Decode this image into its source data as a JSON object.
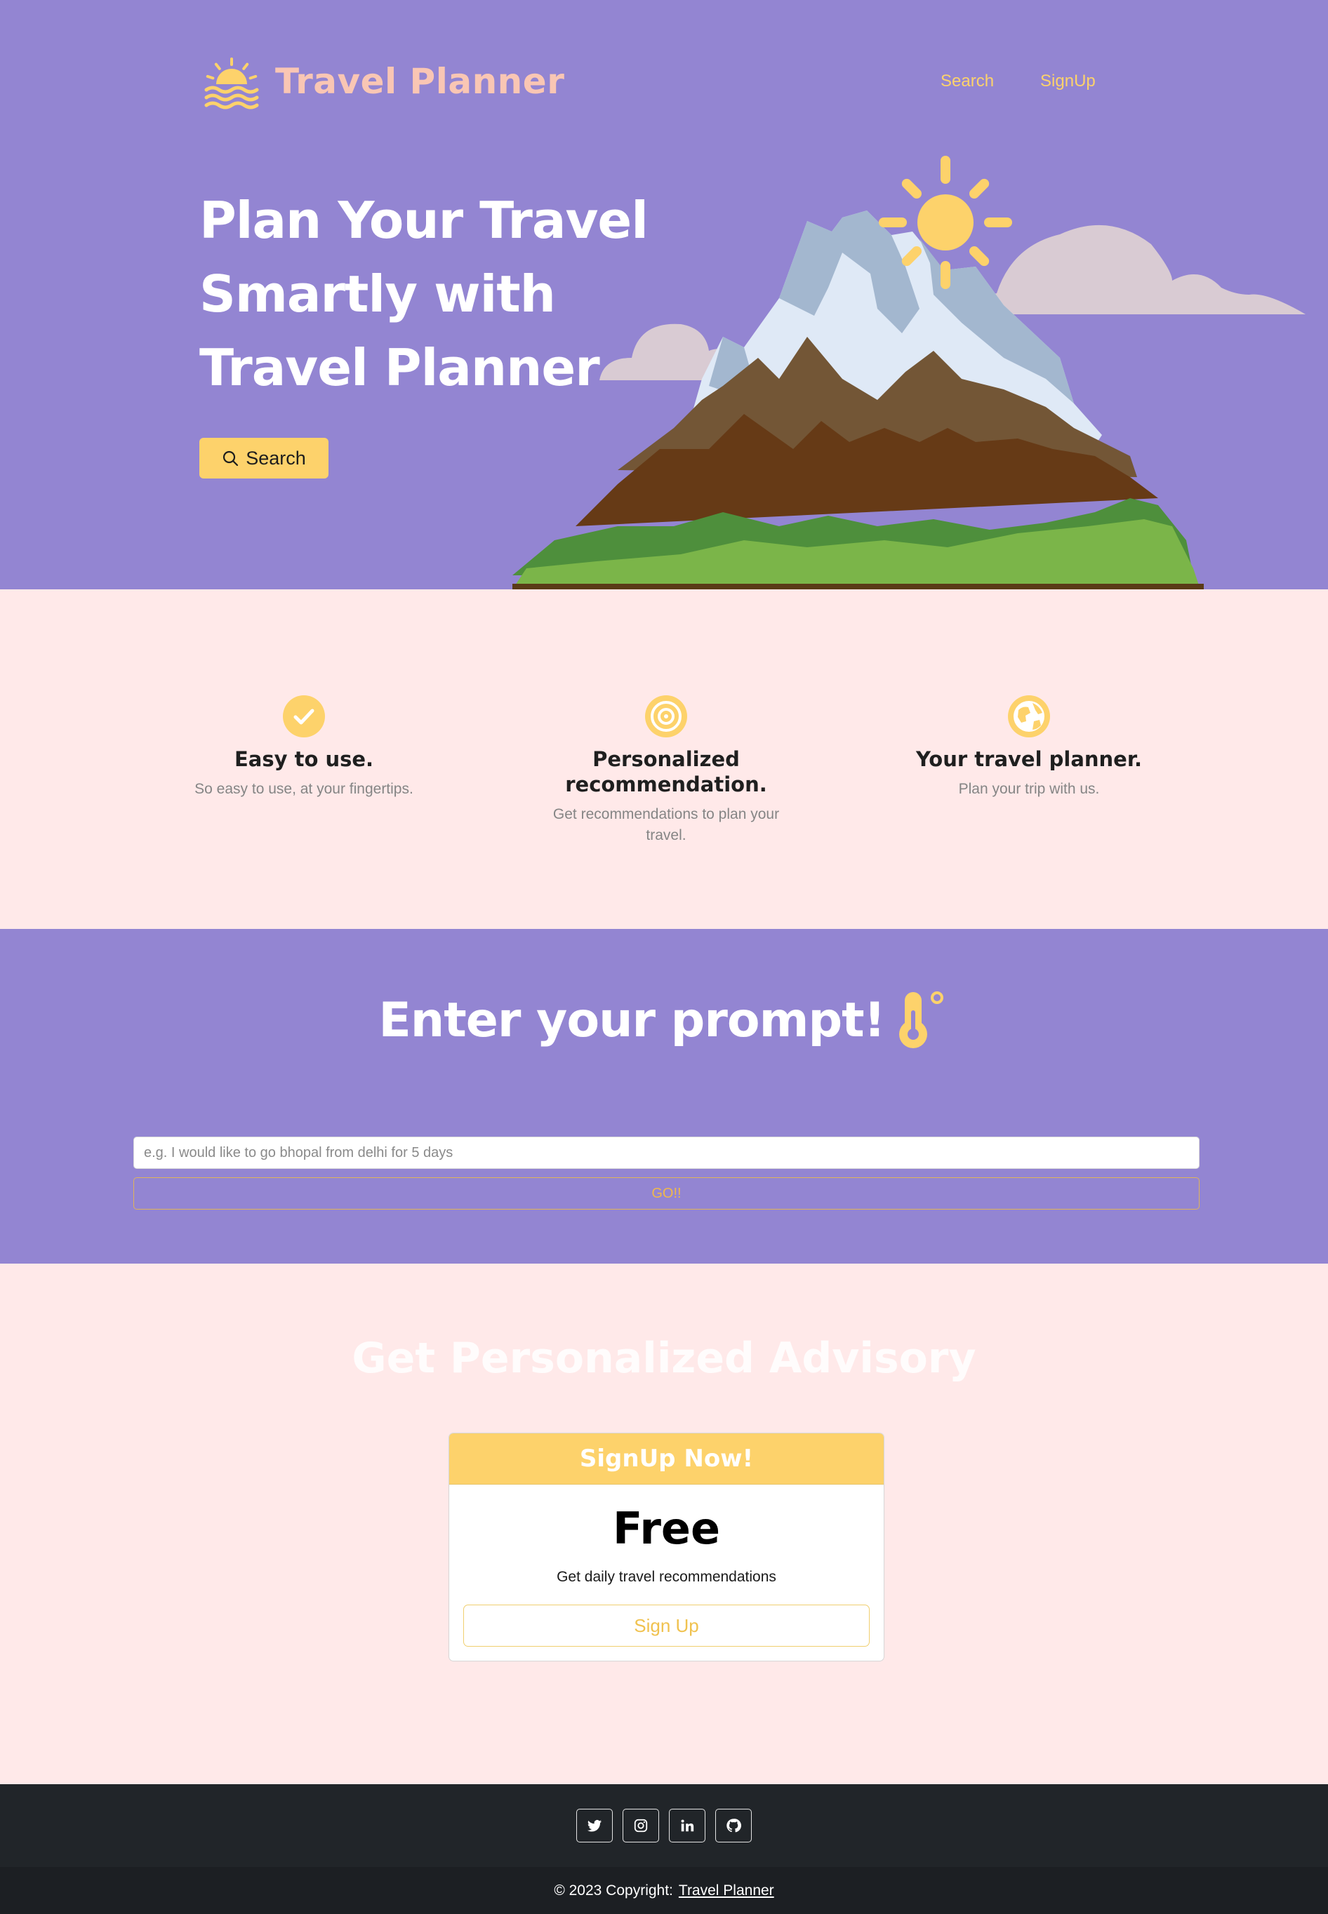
{
  "header": {
    "brand": "Travel Planner",
    "nav": [
      {
        "label": "Search"
      },
      {
        "label": "SignUp"
      }
    ]
  },
  "hero": {
    "title": "Plan Your Travel Smartly with Travel Planner",
    "button_label": "Search",
    "button_icon": "search-icon"
  },
  "features": [
    {
      "icon": "check-circle-icon",
      "title": "Easy to use.",
      "text": "So easy to use, at your fingertips."
    },
    {
      "icon": "target-icon",
      "title": "Personalized recommendation.",
      "text": "Get recommendations to plan your travel."
    },
    {
      "icon": "globe-icon",
      "title": "Your travel planner.",
      "text": "Plan your trip with us."
    }
  ],
  "prompt": {
    "title": "Enter your prompt!",
    "title_icon": "thermometer-icon",
    "placeholder": "e.g. I would like to go bhopal from delhi for 5 days",
    "go_label": "GO!!"
  },
  "advisory": {
    "title": "Get Personalized Advisory",
    "card": {
      "header": "SignUp Now!",
      "price": "Free",
      "description": "Get daily travel recommendations",
      "button_label": "Sign Up"
    }
  },
  "footer": {
    "social": [
      "twitter-icon",
      "instagram-icon",
      "linkedin-icon",
      "github-icon"
    ],
    "copyright": "© 2023 Copyright:",
    "copyright_link": "Travel Planner"
  },
  "colors": {
    "hero_bg": "#9385d2",
    "page_bg": "#ffe9e9",
    "accent": "#fdd26b",
    "brand_text": "#f9c6b4",
    "footer_bg": "#212529"
  }
}
